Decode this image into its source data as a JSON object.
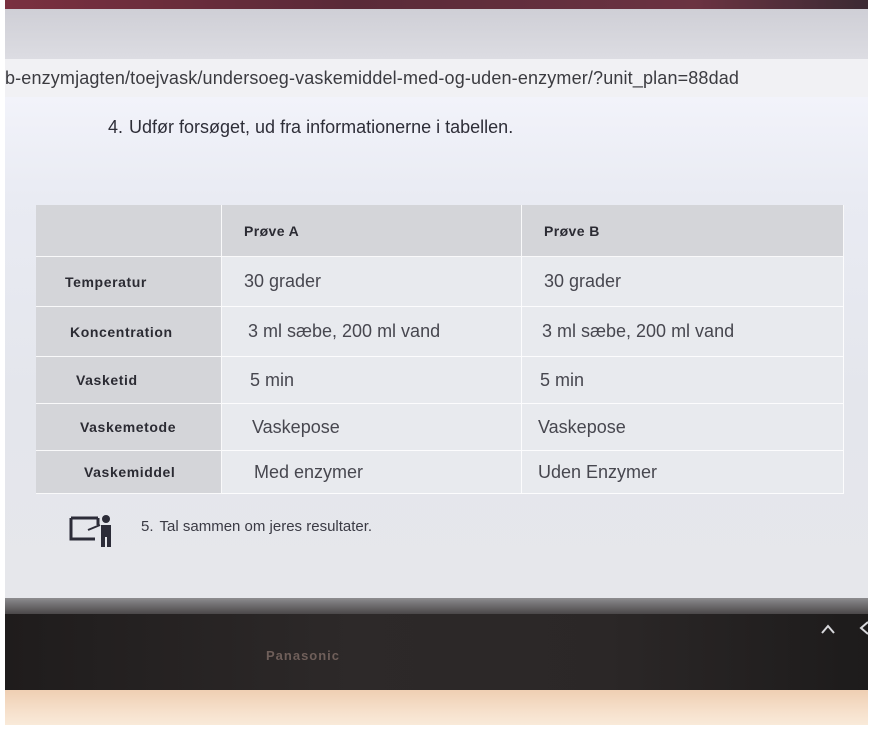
{
  "browser": {
    "url": "b-enzymjagten/toejvask/undersoeg-vaskemiddel-med-og-uden-enzymer/?unit_plan=88dad"
  },
  "page": {
    "step4": {
      "number": "4.",
      "text": "Udfør forsøget, ud fra informationerne i tabellen."
    },
    "table": {
      "headers": [
        "",
        "Prøve A",
        "Prøve B"
      ],
      "rows": [
        {
          "label": "Temperatur",
          "a": "30 grader",
          "b": "30 grader"
        },
        {
          "label": "Koncentration",
          "a": "3 ml sæbe, 200 ml vand",
          "b": "3 ml sæbe, 200 ml vand"
        },
        {
          "label": "Vasketid",
          "a": "5 min",
          "b": "5 min"
        },
        {
          "label": "Vaskemetode",
          "a": "Vaskepose",
          "b": "Vaskepose"
        },
        {
          "label": "Vaskemiddel",
          "a": "Med enzymer",
          "b": "Uden Enzymer"
        }
      ]
    },
    "step5": {
      "number": "5.",
      "text": "Tal sammen om jeres resultater.",
      "icon": "presentation-board-icon"
    }
  },
  "laptop": {
    "brand": "Panasonic",
    "tray_icons": [
      "chevron-up-icon",
      "chevron-left-icon"
    ]
  },
  "colors": {
    "header_bg": "#d4d5d9",
    "cell_bg": "#e8eaee",
    "bezel": "#2b2727",
    "laptop_body": "#f3d7be"
  }
}
